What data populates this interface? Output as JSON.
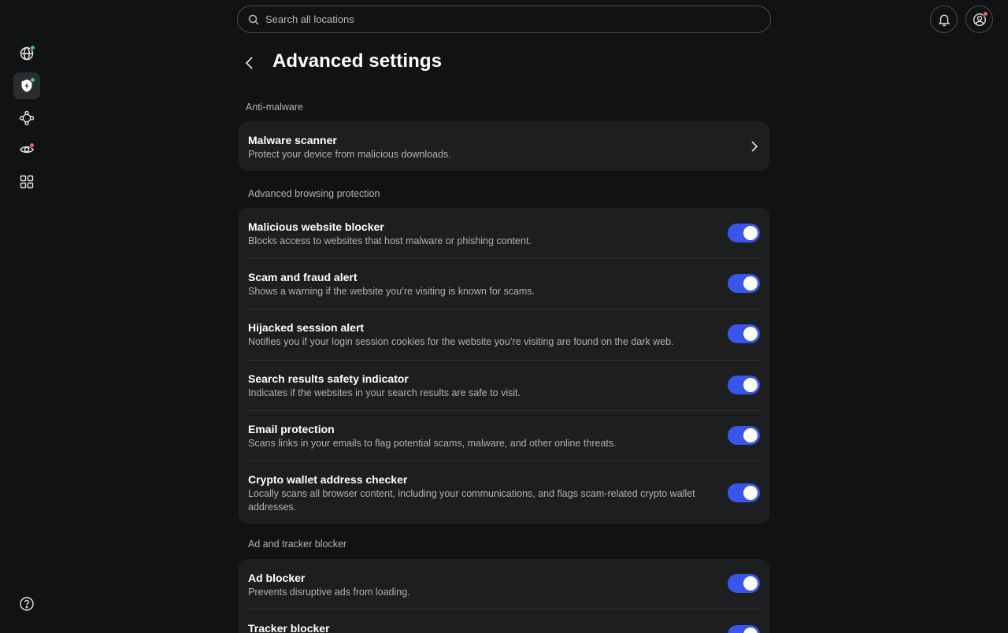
{
  "header": {
    "search_placeholder": "Search all locations"
  },
  "sidebar": {
    "items": [
      {
        "icon": "globe-icon",
        "badge_color": "#3ecf6e"
      },
      {
        "icon": "shield-icon",
        "badge_color": "#3ecf6e",
        "active": true
      },
      {
        "icon": "mesh-network-icon"
      },
      {
        "icon": "dark-web-monitor-icon",
        "badge_color": "#f06464"
      },
      {
        "icon": "apps-grid-icon"
      },
      {
        "icon": "help-icon"
      }
    ]
  },
  "colors": {
    "background": "#111213",
    "card": "#1d1e20",
    "toggle_on": "#3a55ea",
    "status_green": "#3ecf6e",
    "status_red": "#f06464"
  },
  "page": {
    "title": "Advanced settings"
  },
  "sections": [
    {
      "label": "Anti-malware",
      "rows": [
        {
          "title": "Malware scanner",
          "desc": "Protect your device from malicious downloads.",
          "control": "chevron"
        }
      ]
    },
    {
      "label": "Advanced browsing protection",
      "rows": [
        {
          "title": "Malicious website blocker",
          "desc": "Blocks access to websites that host malware or phishing content.",
          "control": "toggle",
          "on": true
        },
        {
          "title": "Scam and fraud alert",
          "desc": "Shows a warning if the website you’re visiting is known for scams.",
          "control": "toggle",
          "on": true
        },
        {
          "title": "Hijacked session alert",
          "desc": "Notifies you if your login session cookies for the website you’re visiting are found on the dark web.",
          "control": "toggle",
          "on": true
        },
        {
          "title": "Search results safety indicator",
          "desc": "Indicates if the websites in your search results are safe to visit.",
          "control": "toggle",
          "on": true
        },
        {
          "title": "Email protection",
          "desc": "Scans links in your emails to flag potential scams, malware, and other online threats.",
          "control": "toggle",
          "on": true
        },
        {
          "title": "Crypto wallet address checker",
          "desc": "Locally scans all browser content, including your communications, and flags scam-related crypto wallet addresses.",
          "control": "toggle",
          "on": true
        }
      ]
    },
    {
      "label": "Ad and tracker blocker",
      "rows": [
        {
          "title": "Ad blocker",
          "desc": "Prevents disruptive ads from loading.",
          "control": "toggle",
          "on": true
        },
        {
          "title": "Tracker blocker",
          "desc": "",
          "control": "toggle",
          "on": true
        }
      ]
    }
  ]
}
